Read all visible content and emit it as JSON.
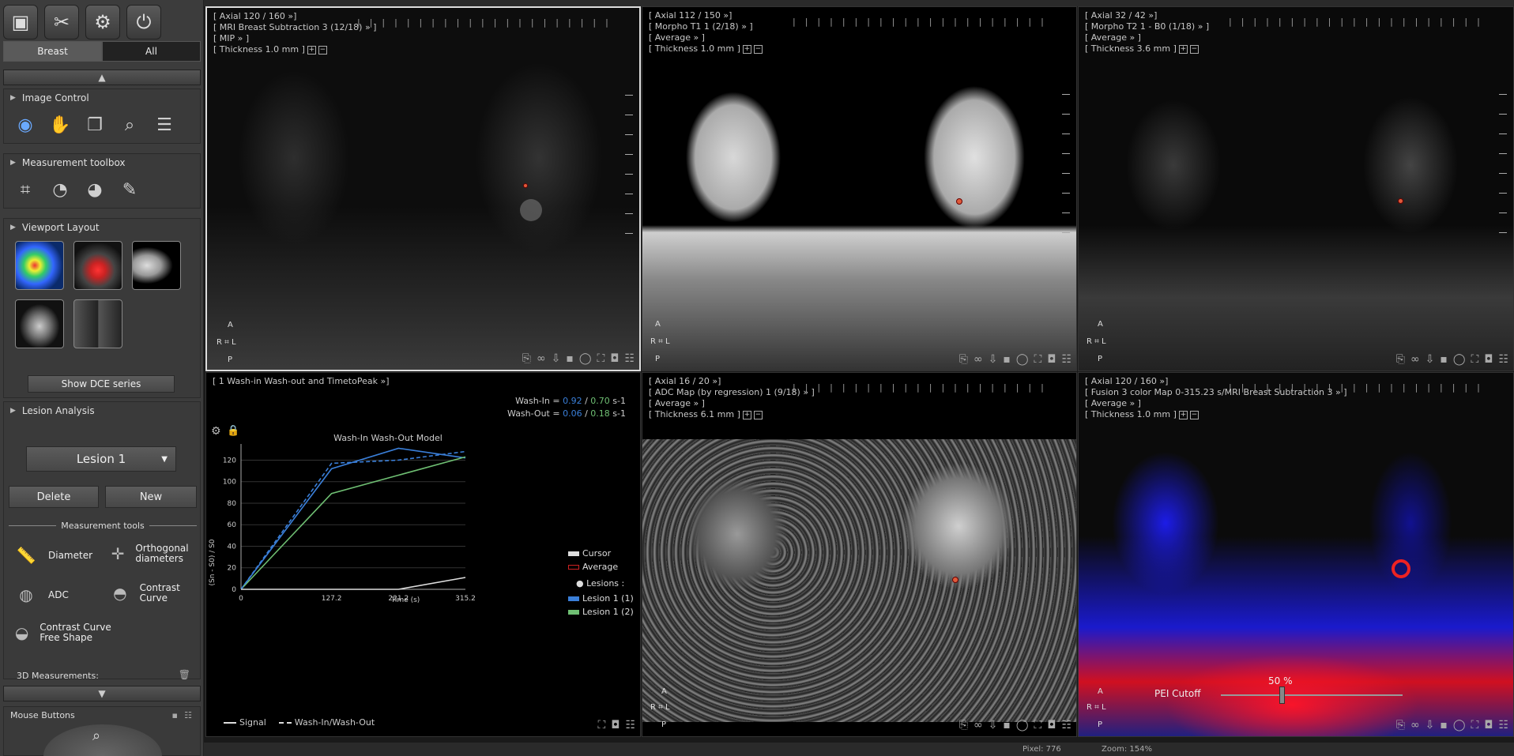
{
  "sidebar": {
    "tabs": [
      "Breast",
      "All"
    ],
    "sections": {
      "image_control": "Image Control",
      "measurement_toolbox": "Measurement toolbox",
      "viewport_layout": "Viewport Layout",
      "lesion_analysis": "Lesion Analysis"
    },
    "show_dce": "Show DCE series",
    "lesion_select": "Lesion 1",
    "delete": "Delete",
    "new": "New",
    "measurement_tools_title": "Measurement tools",
    "tools": {
      "diameter": "Diameter",
      "orthogonal": "Orthogonal diameters",
      "adc": "ADC",
      "contrast_curve": "Contrast Curve",
      "contrast_free": "Contrast Curve Free Shape",
      "measurements_3d": "3D Measurements:"
    },
    "mouse_buttons": "Mouse Buttons"
  },
  "viewports": {
    "v1": {
      "l1": "[ Axial 120 / 160 »]",
      "l2": "[ MRI Breast Subtraction 3  (12/18) » ]",
      "l3": "[ MIP » ]",
      "l4": "[ Thickness 1.0 mm ]"
    },
    "v2": {
      "l1": "[ Axial 112 / 150 »]",
      "l2": "[ Morpho T1 1  (2/18) » ]",
      "l3": "[ Average » ]",
      "l4": "[ Thickness 1.0 mm ]"
    },
    "v3": {
      "l1": "[ Axial 32 / 42 »]",
      "l2": "[ Morpho T2 1 - B0 (1/18) » ]",
      "l3": "[ Average » ]",
      "l4": "[ Thickness 3.6 mm ]"
    },
    "v5": {
      "l1": "[ Axial 16 / 20 »]",
      "l2": "[ ADC Map (by regression) 1  (9/18) » ]",
      "l3": "[ Average » ]",
      "l4": "[ Thickness 6.1 mm ]"
    },
    "v6": {
      "l1": "[ Axial 120 / 160 »]",
      "l2": "[ Fusion 3 color Map 0-315.23 s/MRI Breast Subtraction 3 » ]",
      "l3": "[ Average » ]",
      "l4": "[ Thickness 1.0 mm ]",
      "cutoff_label": "PEI Cutoff",
      "cutoff_value": "50 %"
    },
    "orient": {
      "a": "A",
      "r": "R",
      "l": "L",
      "p": "P"
    }
  },
  "chart_panel": {
    "header": "[ 1 Wash-in Wash-out and TimetoPeak »]",
    "washin_label": "Wash-In =",
    "washin_v1": "0.92",
    "washin_v2": "0.70",
    "washout_label": "Wash-Out =",
    "washout_v1": "0.06",
    "washout_v2": "0.18",
    "unit": "s-1",
    "sep": "/",
    "legend": {
      "cursor": "Cursor",
      "average": "Average",
      "lesions": "Lesions :",
      "l1": "Lesion 1 (1)",
      "l2": "Lesion 1 (2)"
    },
    "bottom_legend": {
      "signal": "Signal",
      "wash": "Wash-In/Wash-Out"
    }
  },
  "chart_data": {
    "type": "line",
    "title": "Wash-In Wash-Out Model",
    "xlabel": "Time (s)",
    "ylabel": "(Sn - S0) / S0",
    "x": [
      0,
      127.2,
      221.2,
      315.2
    ],
    "xticks": [
      "0",
      "127.2",
      "221.2",
      "315.2"
    ],
    "yticks": [
      0,
      20,
      40,
      60,
      80,
      100,
      120
    ],
    "ylim": [
      0,
      135
    ],
    "series": [
      {
        "name": "Lesion 1 (1)",
        "values": [
          0,
          112,
          131,
          122
        ],
        "color": "#3a7fd9"
      },
      {
        "name": "Lesion 1 (2)",
        "values": [
          0,
          89,
          106,
          123
        ],
        "color": "#6fbf73"
      },
      {
        "name": "Wash-In/Wash-Out",
        "values": [
          0,
          117,
          120,
          128
        ],
        "color": "#3a7fd9",
        "dashed": true
      },
      {
        "name": "Signal",
        "values": [
          0,
          0,
          0,
          11
        ],
        "color": "#dddddd"
      }
    ]
  },
  "status": {
    "pixel": "Pixel: 776",
    "zoom": "Zoom: 154%"
  }
}
